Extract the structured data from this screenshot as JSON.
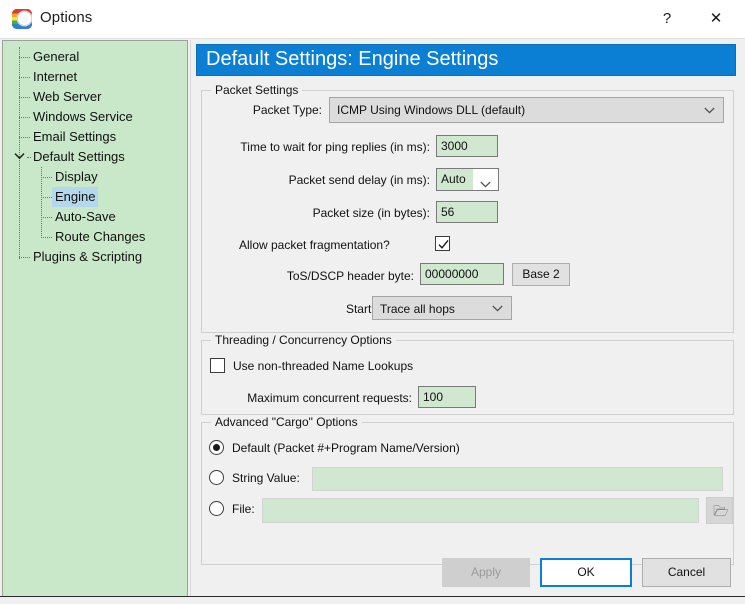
{
  "window": {
    "title": "Options",
    "icon": "app-options-icon",
    "help_glyph": "?",
    "close_glyph": "✕"
  },
  "sidebar": {
    "items": [
      {
        "label": "General",
        "level": 1,
        "selected": false,
        "expander": ""
      },
      {
        "label": "Internet",
        "level": 1,
        "selected": false,
        "expander": ""
      },
      {
        "label": "Web Server",
        "level": 1,
        "selected": false,
        "expander": ""
      },
      {
        "label": "Windows Service",
        "level": 1,
        "selected": false,
        "expander": ""
      },
      {
        "label": "Email Settings",
        "level": 1,
        "selected": false,
        "expander": ""
      },
      {
        "label": "Default Settings",
        "level": 1,
        "selected": false,
        "expander": "expanded"
      },
      {
        "label": "Display",
        "level": 2,
        "selected": false,
        "expander": ""
      },
      {
        "label": "Engine",
        "level": 2,
        "selected": true,
        "expander": ""
      },
      {
        "label": "Auto-Save",
        "level": 2,
        "selected": false,
        "expander": ""
      },
      {
        "label": "Route Changes",
        "level": 2,
        "selected": false,
        "expander": ""
      },
      {
        "label": "Plugins & Scripting",
        "level": 1,
        "selected": false,
        "expander": ""
      }
    ]
  },
  "page": {
    "banner_title": "Default Settings: Engine Settings",
    "banner_color": "#0a7fd4"
  },
  "packet_settings": {
    "group_title": "Packet Settings",
    "packet_type_label": "Packet Type:",
    "packet_type_value": "ICMP Using Windows DLL (default)",
    "wait_label": "Time to wait for ping replies (in ms):",
    "wait_value": "3000",
    "send_delay_label": "Packet send delay (in ms):",
    "send_delay_value": "Auto",
    "packet_size_label": "Packet size (in bytes):",
    "packet_size_value": "56",
    "fragmentation_label": "Allow packet fragmentation?",
    "fragmentation_checked": true,
    "tos_label": "ToS/DSCP header byte:",
    "tos_value": "00000000",
    "base_button_label": "Base 2",
    "starting_hop_label": "Starting hop:",
    "starting_hop_value": "Trace all hops"
  },
  "threading": {
    "group_title": "Threading / Concurrency Options",
    "non_threaded_label": "Use non-threaded Name Lookups",
    "non_threaded_checked": false,
    "max_requests_label": "Maximum concurrent requests:",
    "max_requests_value": "100"
  },
  "cargo": {
    "group_title": "Advanced \"Cargo\" Options",
    "selected_option": "default",
    "options": [
      {
        "id": "default",
        "label": "Default (Packet #+Program Name/Version)"
      },
      {
        "id": "string",
        "label": "String Value:"
      },
      {
        "id": "file",
        "label": "File:"
      }
    ],
    "string_value": "",
    "file_value": "",
    "browse_icon": "open-folder-icon"
  },
  "footer": {
    "apply_label": "Apply",
    "apply_enabled": false,
    "ok_label": "OK",
    "cancel_label": "Cancel"
  }
}
